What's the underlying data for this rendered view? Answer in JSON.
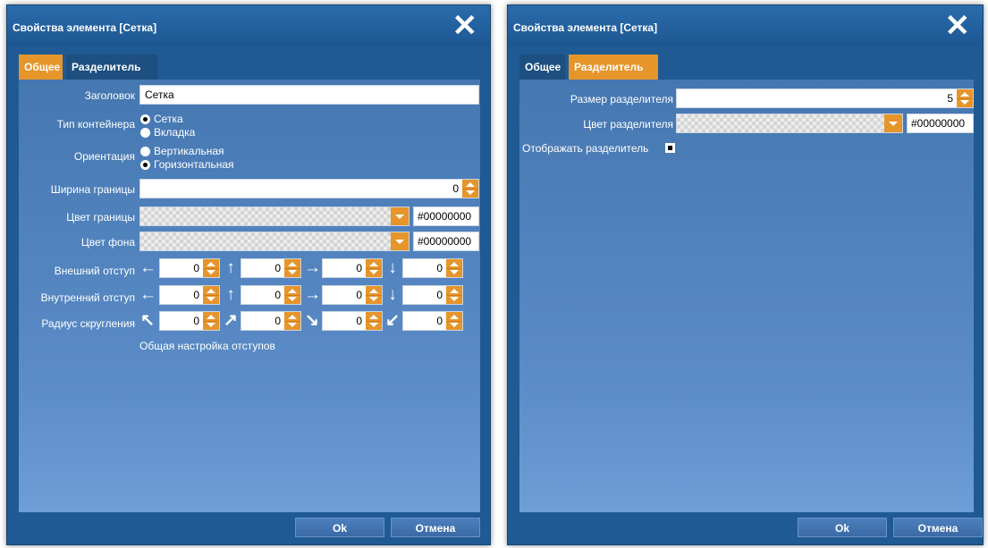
{
  "dialog1": {
    "title": "Свойства элемента [Сетка]",
    "tabs": [
      {
        "label": "Общее",
        "active": true
      },
      {
        "label": "Разделитель",
        "active": false
      }
    ],
    "fields": {
      "heading_label": "Заголовок",
      "heading_value": "Сетка",
      "container_type_label": "Тип контейнера",
      "container_type_options": [
        {
          "label": "Сетка",
          "checked": true
        },
        {
          "label": "Вкладка",
          "checked": false
        }
      ],
      "orientation_label": "Ориентация",
      "orientation_options": [
        {
          "label": "Вертикальная",
          "checked": false
        },
        {
          "label": "Горизонтальная",
          "checked": true
        }
      ],
      "border_width_label": "Ширина границы",
      "border_width_value": "0",
      "border_color_label": "Цвет границы",
      "border_color_value": "#00000000",
      "bg_color_label": "Цвет фона",
      "bg_color_value": "#00000000",
      "margin_label": "Внешний отступ",
      "margin_values": [
        "0",
        "0",
        "0",
        "0"
      ],
      "padding_label": "Внутренний отступ",
      "padding_values": [
        "0",
        "0",
        "0",
        "0"
      ],
      "radius_label": "Радиус скругления",
      "radius_values": [
        "0",
        "0",
        "0",
        "0"
      ],
      "common_link": "Общая настройка отступов"
    },
    "icons": {
      "margin": [
        "arrow-left-icon",
        "arrow-up-icon",
        "arrow-right-icon",
        "arrow-down-icon"
      ],
      "radius": [
        "arrow-up-left-icon",
        "arrow-up-right-icon",
        "arrow-down-right-icon",
        "arrow-down-left-icon"
      ]
    },
    "ok_label": "Ok",
    "cancel_label": "Отмена"
  },
  "dialog2": {
    "title": "Свойства элемента [Сетка]",
    "tabs": [
      {
        "label": "Общее",
        "active": false
      },
      {
        "label": "Разделитель",
        "active": true
      }
    ],
    "fields": {
      "size_label": "Размер разделителя",
      "size_value": "5",
      "color_label": "Цвет разделителя",
      "color_value": "#00000000",
      "show_label": "Отображать разделитель",
      "show_checked": true
    },
    "ok_label": "Ok",
    "cancel_label": "Отмена"
  },
  "colors": {
    "accent": "#e6952b",
    "dialog_bg": "#1f5a95",
    "panel_bg": "#5b8cc7"
  }
}
